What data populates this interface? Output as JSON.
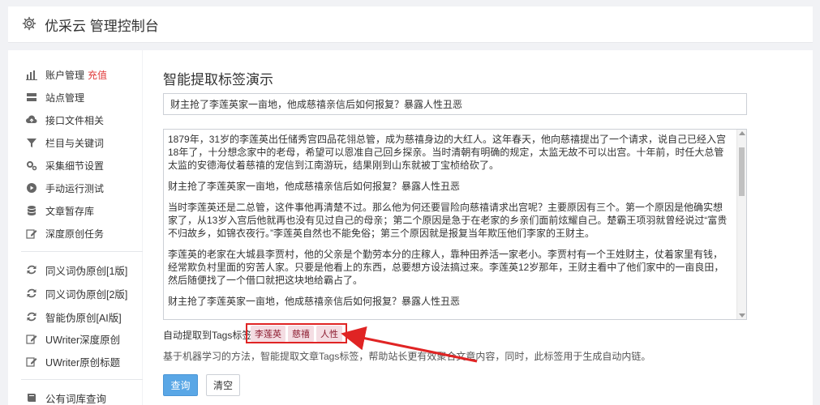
{
  "app": {
    "title": "优采云 管理控制台"
  },
  "sidebar": {
    "items": [
      {
        "label": "账户管理",
        "badge": "充值",
        "icon": "bar-chart-icon"
      },
      {
        "label": "站点管理",
        "icon": "server-icon"
      },
      {
        "label": "接口文件相关",
        "icon": "cloud-upload-icon"
      },
      {
        "label": "栏目与关键词",
        "icon": "filter-icon"
      },
      {
        "label": "采集细节设置",
        "icon": "cogs-icon"
      },
      {
        "label": "手动运行测试",
        "icon": "play-circle-icon"
      },
      {
        "label": "文章暂存库",
        "icon": "database-icon"
      },
      {
        "label": "深度原创任务",
        "icon": "edit-icon"
      },
      {
        "label": "同义词伪原创[1版]",
        "icon": "refresh-icon"
      },
      {
        "label": "同义词伪原创[2版]",
        "icon": "refresh-icon"
      },
      {
        "label": "智能伪原创[AI版]",
        "icon": "refresh-icon"
      },
      {
        "label": "UWriter深度原创",
        "icon": "edit-icon"
      },
      {
        "label": "UWriter原创标题",
        "icon": "edit-icon"
      },
      {
        "label": "公有词库查询",
        "icon": "book-icon"
      }
    ]
  },
  "main": {
    "heading": "智能提取标签演示",
    "title_value": "财主抢了李莲英家一亩地，他成慈禧亲信后如何报复？暴露人性丑恶",
    "article": [
      "1879年，31岁的李莲英出任储秀宫四品花翎总管，成为慈禧身边的大红人。这年春天，他向慈禧提出了一个请求，说自己已经入宫18年了，十分想念家中的老母，希望可以恩准自己回乡探亲。当时清朝有明确的规定，太监无故不可以出宫。十年前，时任大总管太监的安德海仗着慈禧的宠信到江南游玩，结果刚到山东就被丁宝桢给砍了。",
      "财主抢了李莲英家一亩地，他成慈禧亲信后如何报复？暴露人性丑恶",
      "当时李莲英还是二总管，这件事他再清楚不过。那么他为何还要冒险向慈禧请求出宫呢？主要原因有三个。第一个原因是他确实想家了，从13岁入宫后他就再也没有见过自己的母亲；第二个原因是急于在老家的乡亲们面前炫耀自己。楚霸王项羽就曾经说过“富贵不归故乡，如锦衣夜行。”李莲英自然也不能免俗；第三个原因就是报复当年欺压他们李家的王财主。",
      "李莲英的老家在大城县李贾村，他的父亲是个勤劳本分的庄稼人，靠种田养活一家老小。李贾村有一个王姓财主，仗着家里有钱，经常欺负村里面的穷苦人家。只要是他看上的东西，总要想方设法搞过来。李莲英12岁那年，王财主看中了他们家中的一亩良田，然后随便找了一个借口就把这块地给霸占了。",
      "财主抢了李莲英家一亩地，他成慈禧亲信后如何报复？暴露人性丑恶"
    ],
    "tags_label": "自动提取到Tags标签：",
    "tags": [
      "李莲英",
      "慈禧",
      "人性"
    ],
    "description": "基于机器学习的方法，智能提取文章Tags标签，帮助站长更有效聚合文章内容，同时，此标签用于生成自动内链。",
    "query_button": "查询",
    "clear_button": "清空"
  },
  "colors": {
    "accent": "#5aa7e6",
    "highlight": "#e02424",
    "tag_bg": "#f4dde3",
    "tag_text": "#8b1a2e",
    "badge": "#e03a3a"
  }
}
